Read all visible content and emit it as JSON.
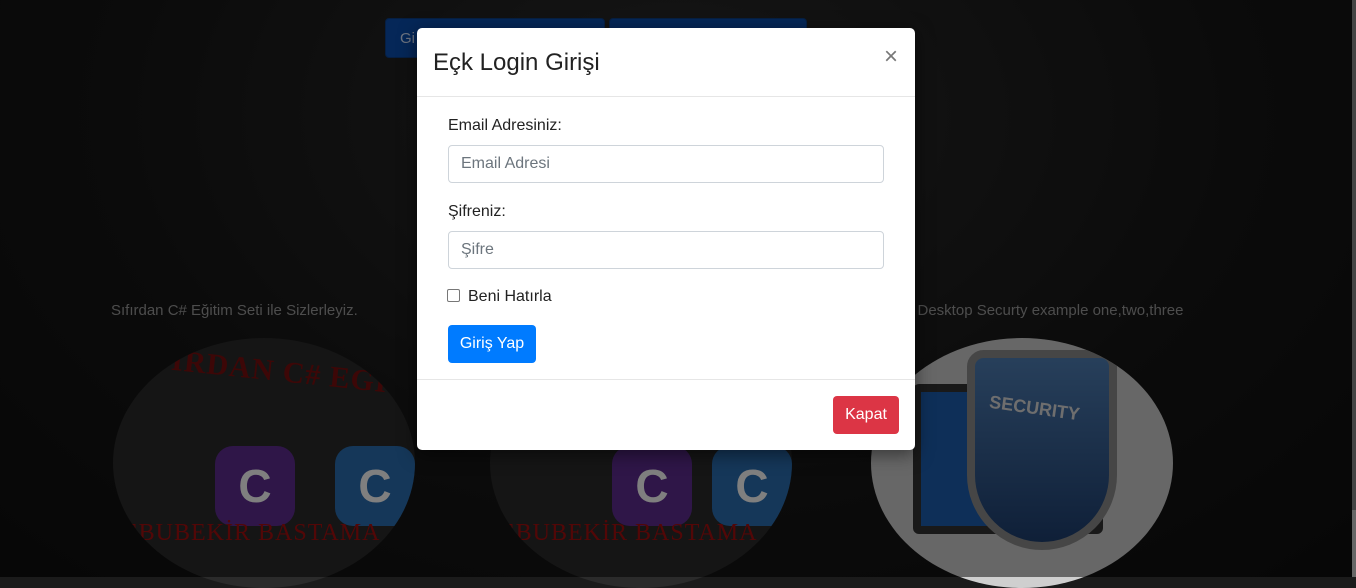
{
  "background": {
    "nav_buttons": [
      "Gi",
      ""
    ],
    "captions": [
      "Sıfırdan C# Eğitim Seti ile Sizlerleyiz.",
      "or Desktop Securty example one,two,three"
    ],
    "cards": [
      {
        "title": "SIFIRDAN C# EĞİTİM SETİ",
        "author": "EBUBEKİR BASTAMA"
      },
      {
        "author": "EBUBEKİR BASTAMA"
      },
      {
        "label": "SECURITY"
      }
    ],
    "colors": {
      "nav_button": "#0a4fb0",
      "overlay": "rgba(0,0,0,0.5)"
    }
  },
  "modal": {
    "title": "Eçk Login Girişi",
    "close_symbol": "×",
    "email_label": "Email Adresiniz:",
    "email_placeholder": "Email Adresi",
    "email_value": "",
    "password_label": "Şifreniz:",
    "password_placeholder": "Şifre",
    "password_value": "",
    "remember_label": "Beni Hatırla",
    "remember_checked": false,
    "login_button": "Giriş Yap",
    "close_button": "Kapat",
    "colors": {
      "primary": "#007bff",
      "danger": "#dc3545"
    }
  }
}
